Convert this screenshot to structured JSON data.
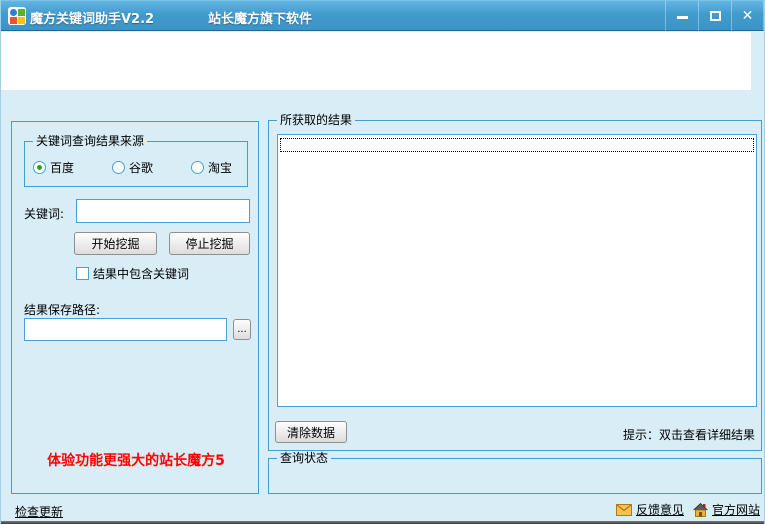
{
  "window": {
    "title": "魔方关键词助手V2.2",
    "subtitle": "站长魔方旗下软件",
    "controls": {
      "minimize": "minimize",
      "maximize": "maximize",
      "close": "✕"
    }
  },
  "left_panel": {
    "source_group": {
      "title": "关键词查询结果来源",
      "options": [
        {
          "label": "百度",
          "selected": true
        },
        {
          "label": "谷歌",
          "selected": false
        },
        {
          "label": "淘宝",
          "selected": false
        }
      ]
    },
    "keyword_label": "关键词:",
    "keyword_value": "",
    "keyword_placeholder": "",
    "start_button": "开始挖掘",
    "stop_button": "停止挖掘",
    "include_checkbox_label": "结果中包含关键词",
    "include_checked": false,
    "save_path_label": "结果保存路径:",
    "save_path_value": "",
    "browse_button": "...",
    "promo_text": "体验功能更强大的站长魔方5",
    "promo_color": "#ff0000"
  },
  "results": {
    "group_title": "所获取的结果",
    "items": [],
    "clear_button": "清除数据",
    "hint": "提示：双击查看详细结果"
  },
  "status": {
    "group_title": "查询状态",
    "text": ""
  },
  "footer": {
    "check_update": "检查更新",
    "feedback": "反馈意见",
    "official_site": "官方网站"
  },
  "colors": {
    "titlebar_blue": "#3b94c7",
    "body_bg": "#d9edf7",
    "panel_border": "#3ba1d4",
    "radio_selected_dot": "#2f9e2f",
    "promo_red": "#ff0000",
    "envelope_yellow": "#f5c24a",
    "house_yellow": "#f0b62a"
  }
}
